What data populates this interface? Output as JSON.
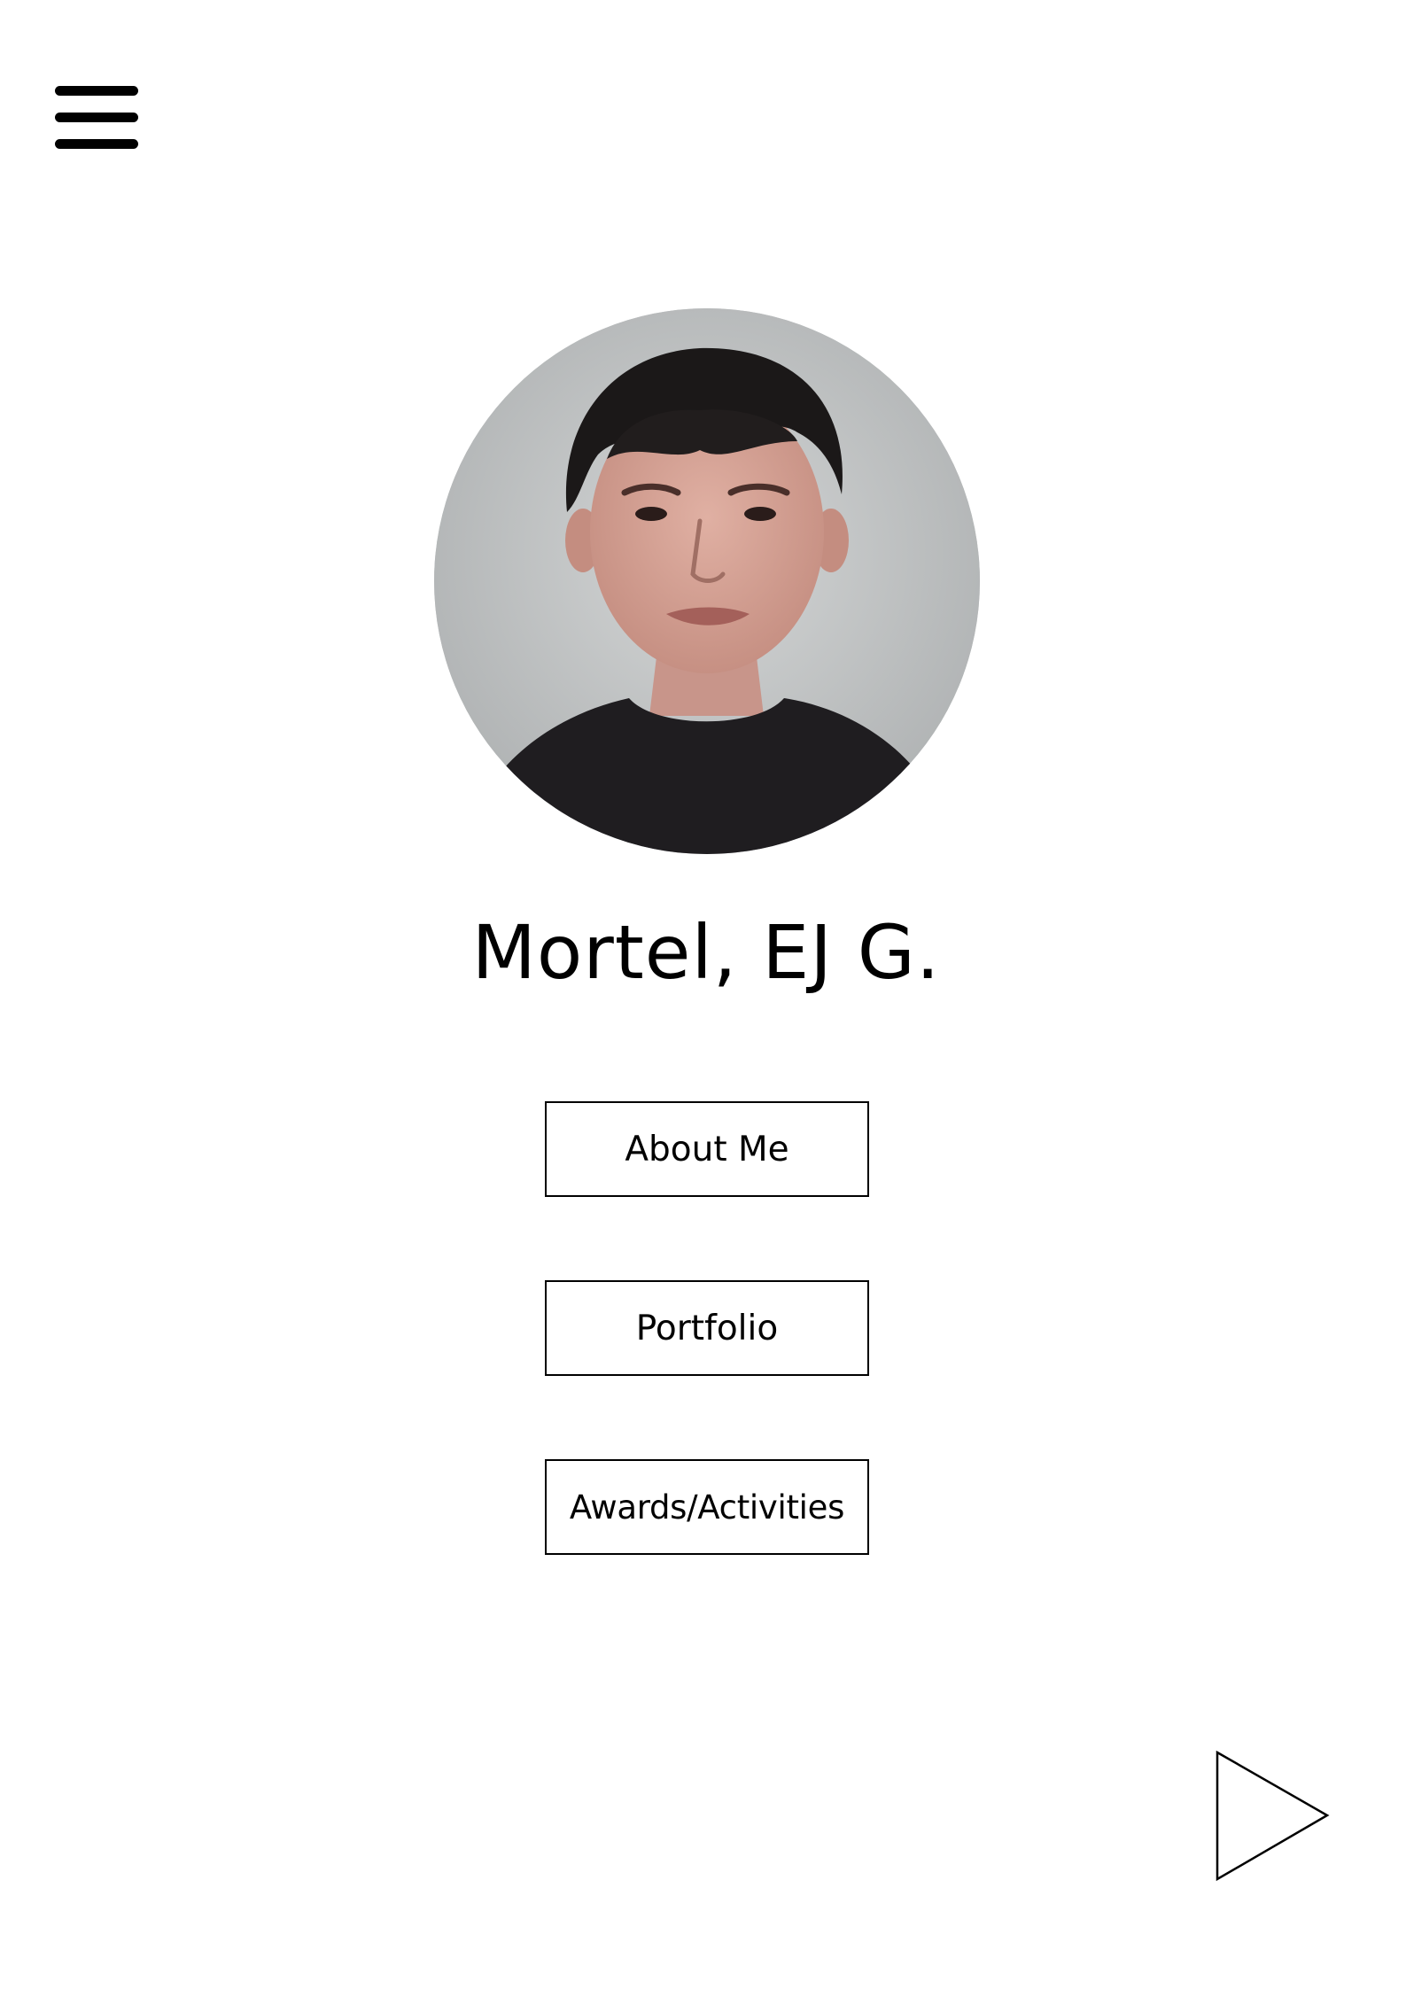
{
  "header": {
    "menu_icon": "hamburger-menu-icon"
  },
  "profile": {
    "photo_description_icon": "profile-photo",
    "name": "Mortel, EJ G."
  },
  "nav": {
    "about_label": "About Me",
    "portfolio_label": "Portfolio",
    "awards_label": "Awards/Activities"
  },
  "footer": {
    "next_icon": "play-arrow-icon"
  },
  "colors": {
    "background": "#ffffff",
    "text": "#000000",
    "photo_background": "#c6c8c9"
  }
}
